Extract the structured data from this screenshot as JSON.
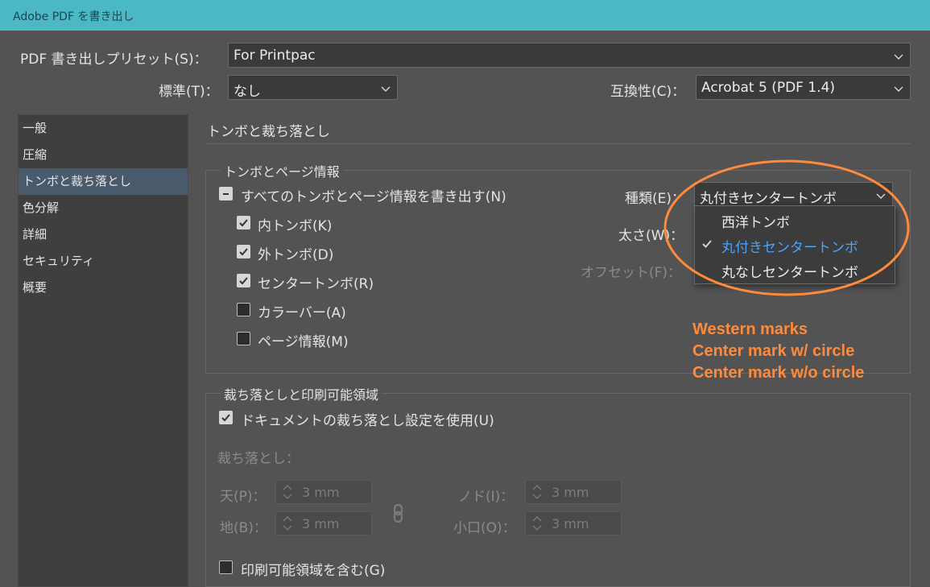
{
  "window": {
    "title": "Adobe PDF を書き出し"
  },
  "preset": {
    "label": "PDF 書き出しプリセット(S)：",
    "value": "For Printpac"
  },
  "standard": {
    "label": "標準(T)：",
    "value": "なし"
  },
  "compat": {
    "label": "互換性(C)：",
    "value": "Acrobat 5 (PDF 1.4)"
  },
  "sidebar": {
    "items": [
      {
        "label": "一般",
        "active": false
      },
      {
        "label": "圧縮",
        "active": false
      },
      {
        "label": "トンボと裁ち落とし",
        "active": true
      },
      {
        "label": "色分解",
        "active": false
      },
      {
        "label": "詳細",
        "active": false
      },
      {
        "label": "セキュリティ",
        "active": false
      },
      {
        "label": "概要",
        "active": false
      }
    ]
  },
  "section": {
    "title": "トンボと裁ち落とし"
  },
  "marks": {
    "legend": "トンボとページ情報",
    "all_label": "すべてのトンボとページ情報を書き出す(N)",
    "all_state": "mixed",
    "items": [
      {
        "label": "内トンボ(K)",
        "checked": true
      },
      {
        "label": "外トンボ(D)",
        "checked": true
      },
      {
        "label": "センタートンボ(R)",
        "checked": true
      },
      {
        "label": "カラーバー(A)",
        "checked": false
      },
      {
        "label": "ページ情報(M)",
        "checked": false
      }
    ],
    "type_label": "種類(E)：",
    "type_value": "丸付きセンタートンボ",
    "weight_label": "太さ(W)：",
    "offset_label": "オフセット(F)："
  },
  "dropdown": {
    "options": [
      {
        "label": "西洋トンボ",
        "selected": false
      },
      {
        "label": "丸付きセンタートンボ",
        "selected": true
      },
      {
        "label": "丸なしセンタートンボ",
        "selected": false
      }
    ]
  },
  "bleed": {
    "legend": "裁ち落としと印刷可能領域",
    "use_doc_label": "ドキュメントの裁ち落とし設定を使用(U)",
    "use_doc_checked": true,
    "bleed_label": "裁ち落とし：",
    "top_label": "天(P)：",
    "top_value": "3 mm",
    "bottom_label": "地(B)：",
    "bottom_value": "3 mm",
    "inside_label": "ノド(I)：",
    "inside_value": "3 mm",
    "outside_label": "小口(O)：",
    "outside_value": "3 mm",
    "slug_label": "印刷可能領域を含む(G)",
    "slug_checked": false
  },
  "annotation": {
    "color": "#ff8a3c",
    "lines": [
      "Western marks",
      "Center mark w/ circle",
      "Center mark w/o circle"
    ]
  }
}
